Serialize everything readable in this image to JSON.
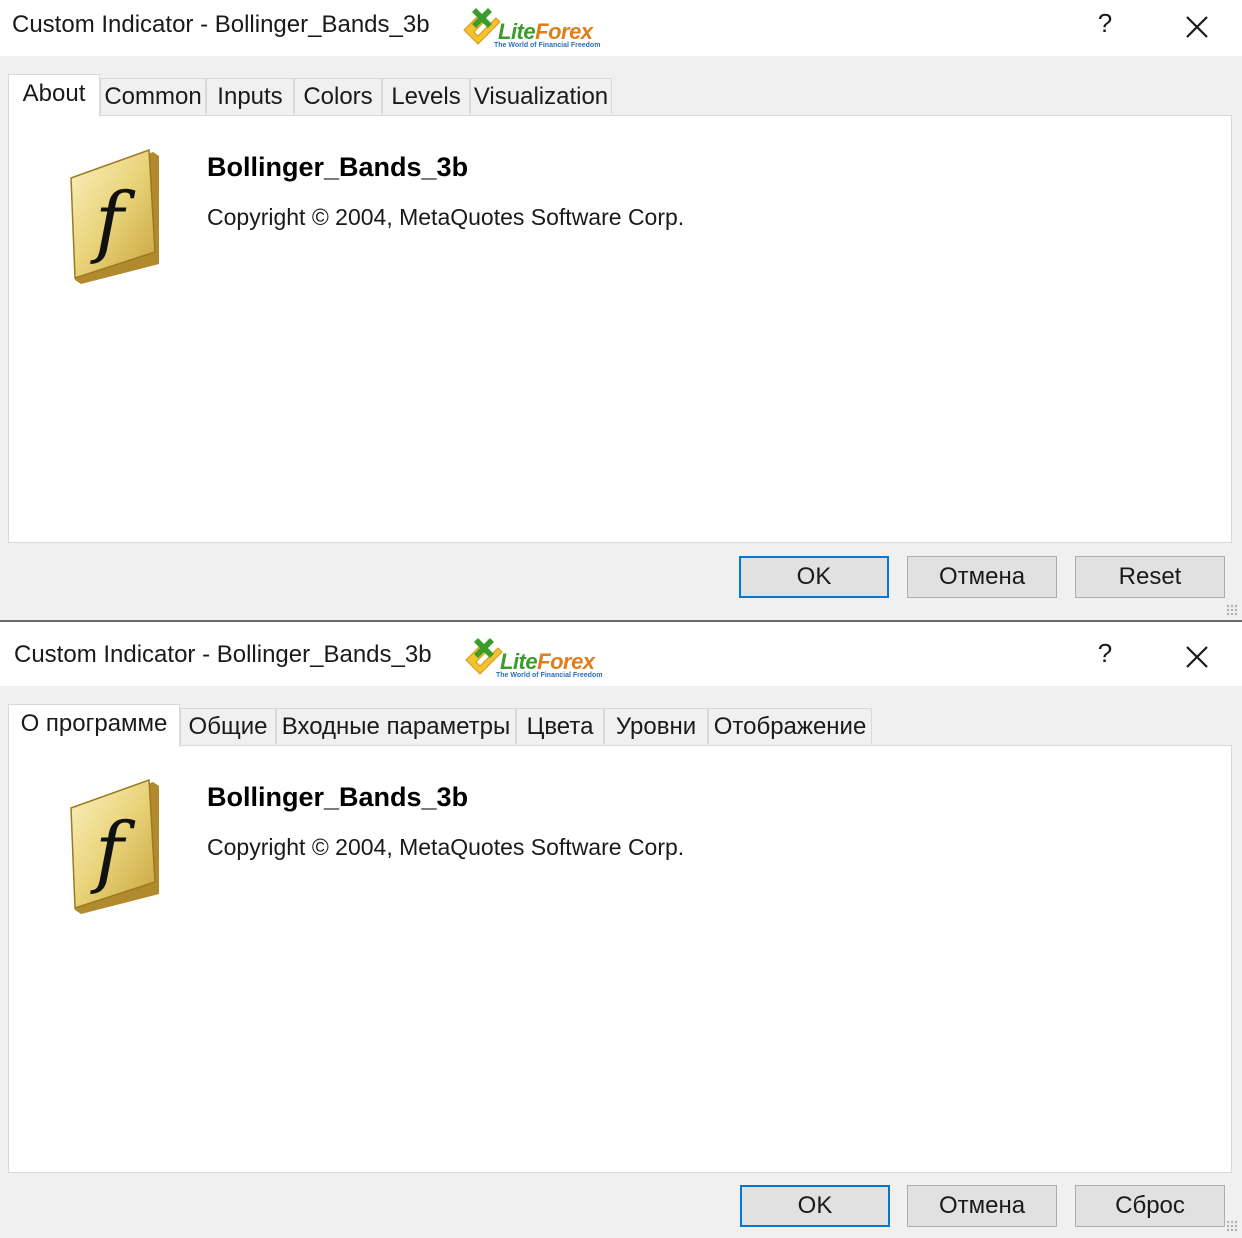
{
  "dialogs": [
    {
      "title": "Custom Indicator - Bollinger_Bands_3b",
      "logo": {
        "brand_a": "Lite",
        "brand_b": "Forex",
        "tagline": "The World of Financial Freedom"
      },
      "help_label": "?",
      "tabs": [
        {
          "label": "About",
          "active": true
        },
        {
          "label": "Common"
        },
        {
          "label": "Inputs"
        },
        {
          "label": "Colors"
        },
        {
          "label": "Levels"
        },
        {
          "label": "Visualization"
        }
      ],
      "about": {
        "icon": "function-f-icon",
        "name": "Bollinger_Bands_3b",
        "copyright": "Copyright © 2004, MetaQuotes Software Corp."
      },
      "buttons": {
        "ok": "OK",
        "cancel": "Отмена",
        "reset": "Reset"
      }
    },
    {
      "title": "Custom Indicator - Bollinger_Bands_3b",
      "logo": {
        "brand_a": "Lite",
        "brand_b": "Forex",
        "tagline": "The World of Financial Freedom"
      },
      "help_label": "?",
      "tabs": [
        {
          "label": "О программе",
          "active": true
        },
        {
          "label": "Общие"
        },
        {
          "label": "Входные параметры"
        },
        {
          "label": "Цвета"
        },
        {
          "label": "Уровни"
        },
        {
          "label": "Отображение"
        }
      ],
      "about": {
        "icon": "function-f-icon",
        "name": "Bollinger_Bands_3b",
        "copyright": "Copyright © 2004, MetaQuotes Software Corp."
      },
      "buttons": {
        "ok": "OK",
        "cancel": "Отмена",
        "reset": "Сброс"
      }
    }
  ],
  "colors": {
    "accent": "#0078d7",
    "logo_green": "#3a9c2a",
    "logo_orange": "#e07d1c",
    "icon_gold": "#e9d37a"
  }
}
